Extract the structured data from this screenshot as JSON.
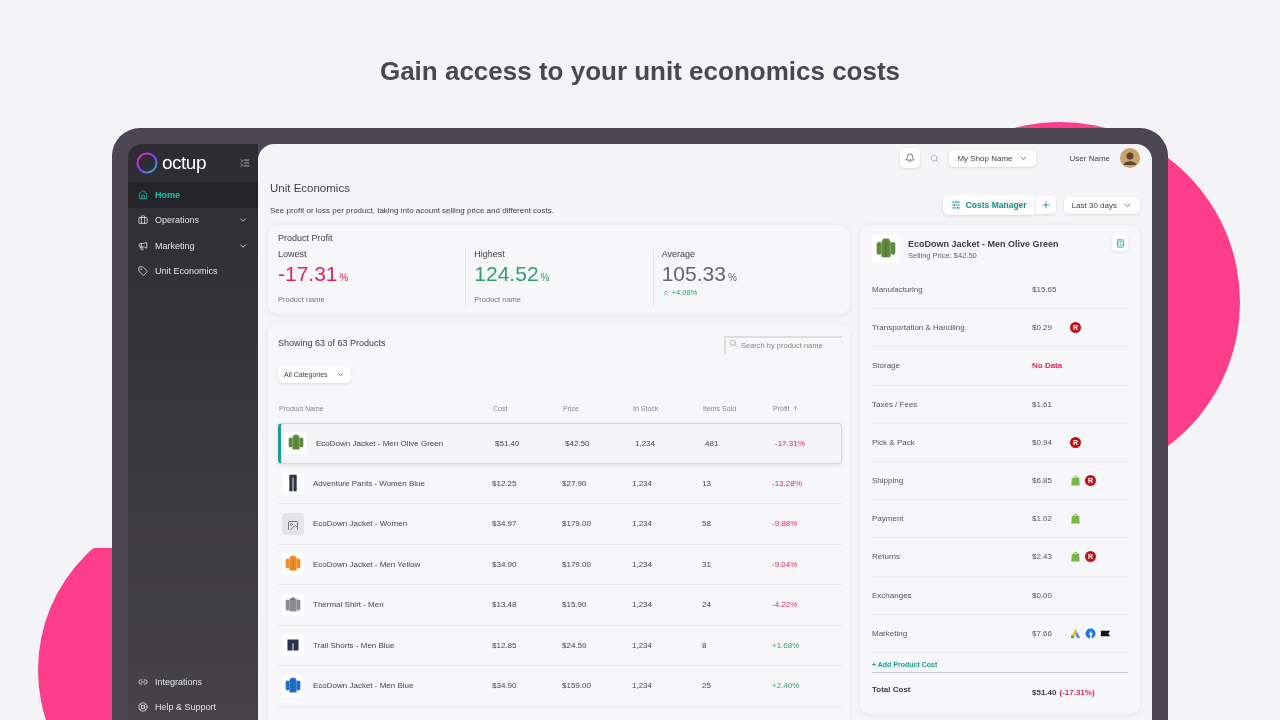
{
  "headline": "Gain access to your unit economics costs",
  "sidebar": {
    "logo": "octup",
    "items": [
      {
        "label": "Home",
        "kind": "home",
        "selected": true,
        "expandable": false
      },
      {
        "label": "Operations",
        "kind": "briefcase",
        "selected": false,
        "expandable": true
      },
      {
        "label": "Marketing",
        "kind": "megaphone",
        "selected": false,
        "expandable": true
      },
      {
        "label": "Unit Economics",
        "kind": "tag",
        "selected": false,
        "expandable": false
      }
    ],
    "footer": [
      {
        "label": "Integrations",
        "kind": "link"
      },
      {
        "label": "Help & Support",
        "kind": "lifebuoy"
      }
    ]
  },
  "topbar": {
    "shop": "My Shop Name",
    "user": "User Name"
  },
  "page": {
    "title": "Unit Economics",
    "subtitle": "See profit or loss per product, taking into acount selling price and different costs.",
    "costs_button": "Costs Manager",
    "range": "Last 30 days"
  },
  "profit": {
    "title": "Product Profit",
    "stats": [
      {
        "label": "Lowest",
        "value": "-17.31",
        "unit": "%",
        "color": "#e0245e",
        "note": "Product name"
      },
      {
        "label": "Highest",
        "value": "124.52",
        "unit": "%",
        "color": "#2e9e6a",
        "note": "Product name"
      },
      {
        "label": "Average",
        "value": "105.33",
        "unit": "%",
        "color": "#666666",
        "change": "+4.08%"
      }
    ]
  },
  "products": {
    "showing": "Showing 63 of 63 Products",
    "search": {
      "placeholder": "Search by product name"
    },
    "category": "All Categories",
    "columns": [
      {
        "label": "Product Name",
        "sorted": false
      },
      {
        "label": "Cost",
        "sorted": false
      },
      {
        "label": "Price",
        "sorted": false
      },
      {
        "label": "In Stock",
        "sorted": false
      },
      {
        "label": "Items Sold",
        "sorted": false
      },
      {
        "label": "Profit",
        "sorted": true
      }
    ],
    "rows": [
      {
        "kind": "jacket",
        "color": "#5f8a3e",
        "name": "EcoDown Jacket - Men Olive Green",
        "cost": "$51.40",
        "price": "$42.50",
        "stock": "1,234",
        "sold": "481",
        "profit": "-17.31%",
        "loss": true,
        "selected": true
      },
      {
        "kind": "pants",
        "color": "#2c3346",
        "name": "Adventure Pants - Women Blue",
        "cost": "$12.25",
        "price": "$27.90",
        "stock": "1,234",
        "sold": "13",
        "profit": "-13.28%",
        "loss": true,
        "selected": false
      },
      {
        "kind": "placeholder",
        "name": "EcoDown Jacket - Women",
        "cost": "$34.97",
        "price": "$179.00",
        "stock": "1,234",
        "sold": "58",
        "profit": "-9.88%",
        "loss": true,
        "selected": false
      },
      {
        "kind": "jacket",
        "color": "#f08a24",
        "name": "EcoDown Jacket - Men Yellow",
        "cost": "$34.90",
        "price": "$179.00",
        "stock": "1,234",
        "sold": "31",
        "profit": "-9.04%",
        "loss": true,
        "selected": false
      },
      {
        "kind": "shirt",
        "color": "#8a8c8f",
        "name": "Thermal Shirt - Men",
        "cost": "$13.48",
        "price": "$15.90",
        "stock": "1,234",
        "sold": "24",
        "profit": "-4.22%",
        "loss": true,
        "selected": false
      },
      {
        "kind": "shorts",
        "color": "#27324a",
        "name": "Trail Shorts - Men Blue",
        "cost": "$12.85",
        "price": "$24.50",
        "stock": "1,234",
        "sold": "8",
        "profit": "+1.68%",
        "loss": false,
        "selected": false
      },
      {
        "kind": "jacket",
        "color": "#1f6fc4",
        "name": "EcoDown Jacket - Men Blue",
        "cost": "$34.90",
        "price": "$159.00",
        "stock": "1,234",
        "sold": "25",
        "profit": "+2.40%",
        "loss": false,
        "selected": false
      }
    ]
  },
  "detail": {
    "name": "EcoDown Jacket - Men Olive Green",
    "selling_price": "Selling Price: $42.50",
    "costs": [
      {
        "label": "Manufacturing",
        "value": "$15.65",
        "missing": false
      },
      {
        "label": "Transportation & Handling",
        "value": "$0.29",
        "missing": false,
        "sources": [
          {
            "kind": "badge",
            "label": "R"
          }
        ]
      },
      {
        "label": "Storage",
        "value": "No Data",
        "missing": true
      },
      {
        "label": "Taxes / Fees",
        "value": "$1.61",
        "missing": false
      },
      {
        "label": "Pick & Pack",
        "value": "$0.94",
        "missing": false,
        "sources": [
          {
            "kind": "badge",
            "label": "R"
          }
        ]
      },
      {
        "label": "Shipping",
        "value": "$6.85",
        "missing": false,
        "sources": [
          {
            "kind": "bag"
          },
          {
            "kind": "badge",
            "label": "R"
          }
        ]
      },
      {
        "label": "Payment",
        "value": "$1.02",
        "missing": false,
        "sources": [
          {
            "kind": "bag"
          }
        ]
      },
      {
        "label": "Returns",
        "value": "$2.43",
        "missing": false,
        "sources": [
          {
            "kind": "bag"
          },
          {
            "kind": "badge",
            "label": "R"
          }
        ]
      },
      {
        "label": "Exchanges",
        "value": "$0.00",
        "missing": false
      },
      {
        "label": "Marketing",
        "value": "$7.66",
        "missing": false,
        "sources": [
          {
            "kind": "ads"
          },
          {
            "kind": "social"
          },
          {
            "kind": "flag"
          }
        ]
      }
    ],
    "add": "+ Add Product Cost",
    "total_label": "Total Cost",
    "total_value": "$51.40",
    "total_change": "(-17.31%)"
  }
}
